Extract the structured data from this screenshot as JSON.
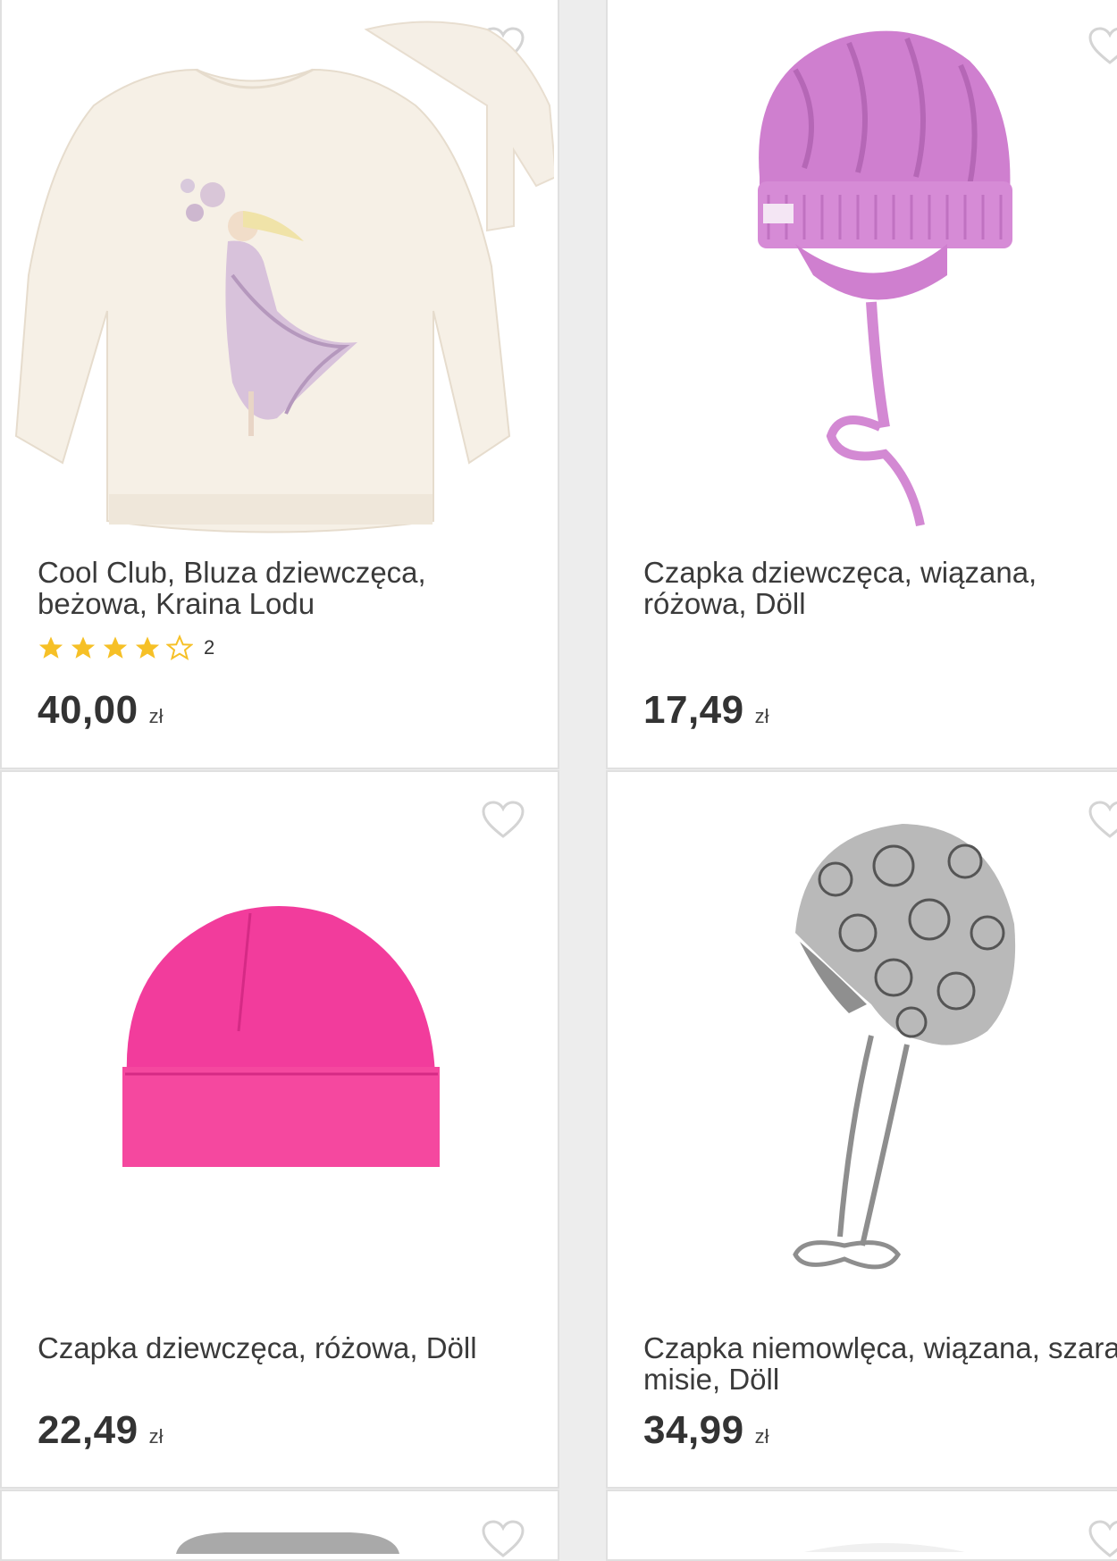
{
  "products": [
    {
      "title": "Cool Club, Bluza dziewczęca, beżowa, Kraina Lodu",
      "rating": 4,
      "rating_max": 5,
      "review_count": "2",
      "price": "40,00",
      "currency": "zł"
    },
    {
      "title": "Czapka dziewczęca, wiązana, różowa, Döll",
      "price": "17,49",
      "currency": "zł"
    },
    {
      "title": "Czapka dziewczęca, różowa, Döll",
      "price": "22,49",
      "currency": "zł"
    },
    {
      "title": "Czapka niemowlęca, wiązana, szara, misie, Döll",
      "price": "34,99",
      "currency": "zł"
    }
  ],
  "colors": {
    "star": "#f6c026",
    "price": "#333333",
    "background": "#ededed",
    "card": "#ffffff"
  }
}
